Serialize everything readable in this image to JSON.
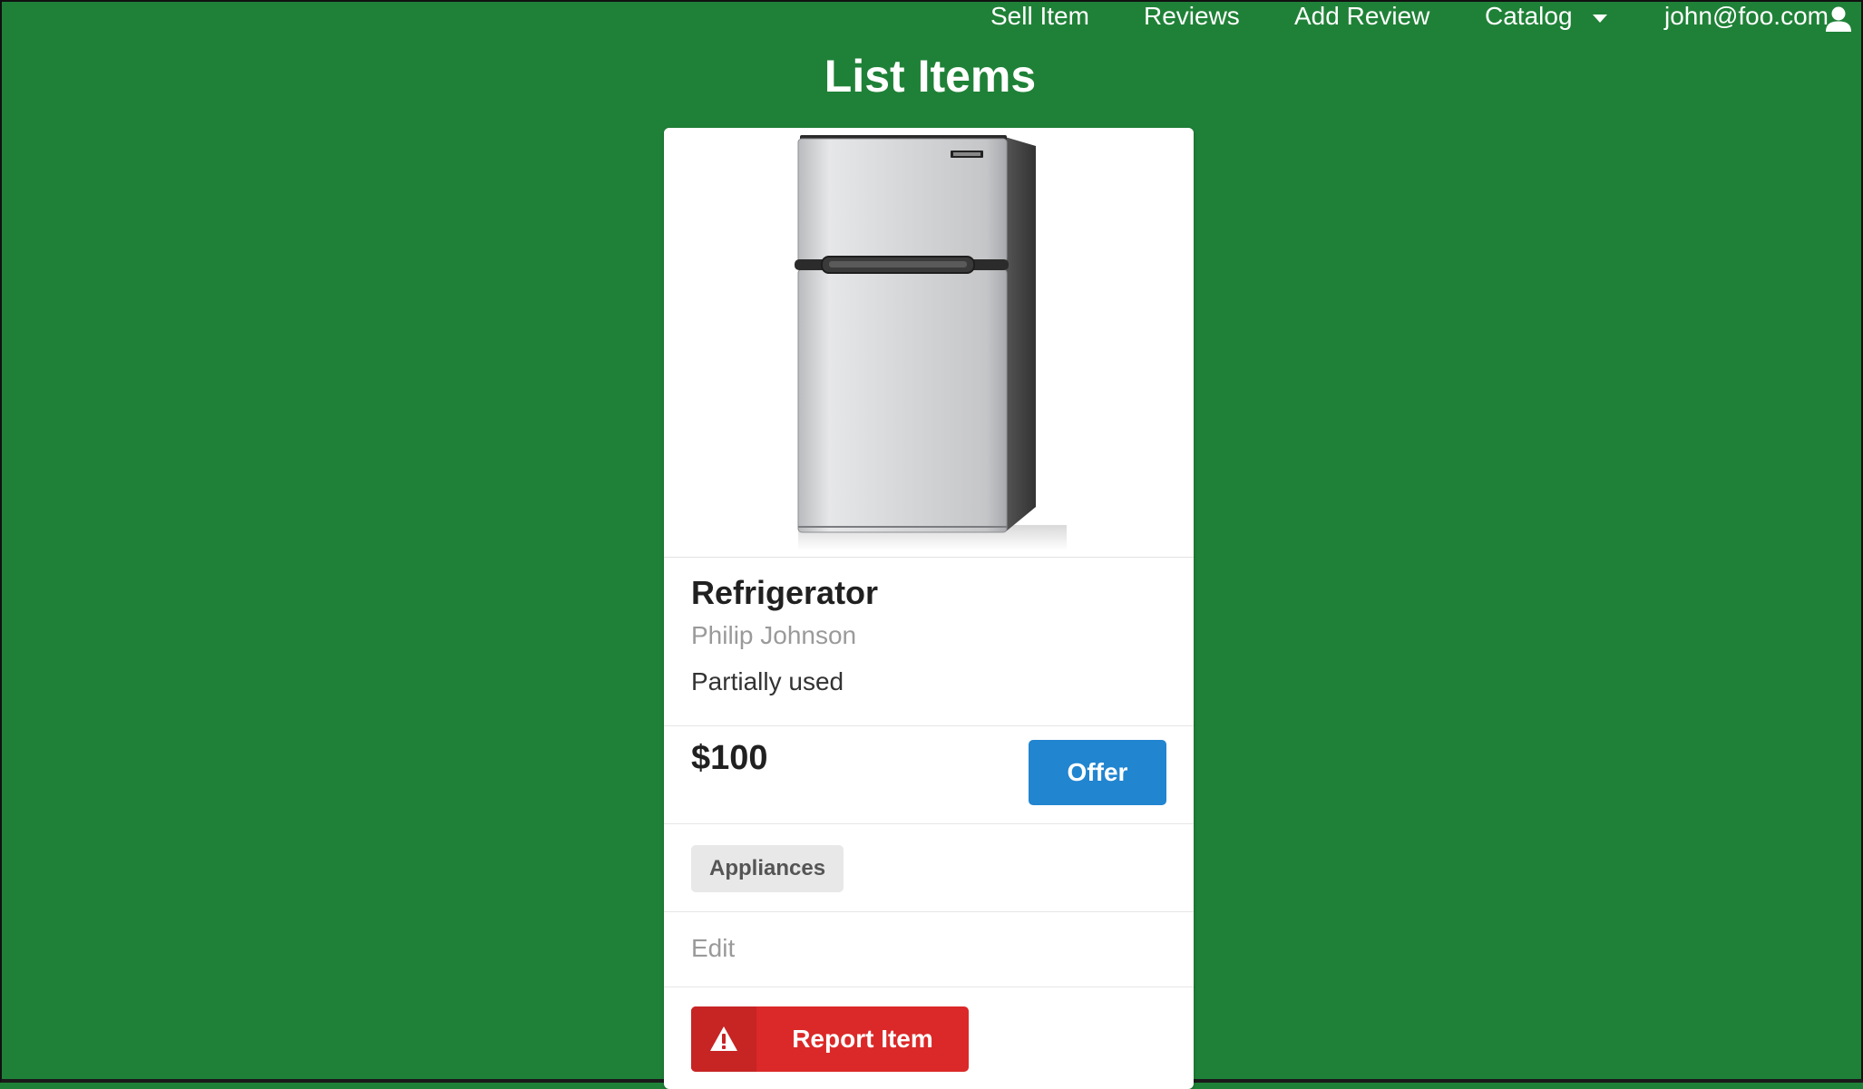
{
  "nav": {
    "sell_item": "Sell Item",
    "reviews": "Reviews",
    "add_review": "Add Review",
    "catalog": "Catalog",
    "user_email": "john@foo.com"
  },
  "page": {
    "title": "List Items"
  },
  "item": {
    "image_icon": "refrigerator-image",
    "name": "Refrigerator",
    "seller": "Philip Johnson",
    "condition": "Partially used",
    "price": "$100",
    "offer_label": "Offer",
    "category": "Appliances",
    "edit_label": "Edit",
    "report_label": "Report Item",
    "report_icon": "warning-icon"
  },
  "colors": {
    "background": "#1f8137",
    "offer_button": "#2185d0",
    "report_button": "#db2828",
    "tag_background": "#e8e8e8"
  }
}
